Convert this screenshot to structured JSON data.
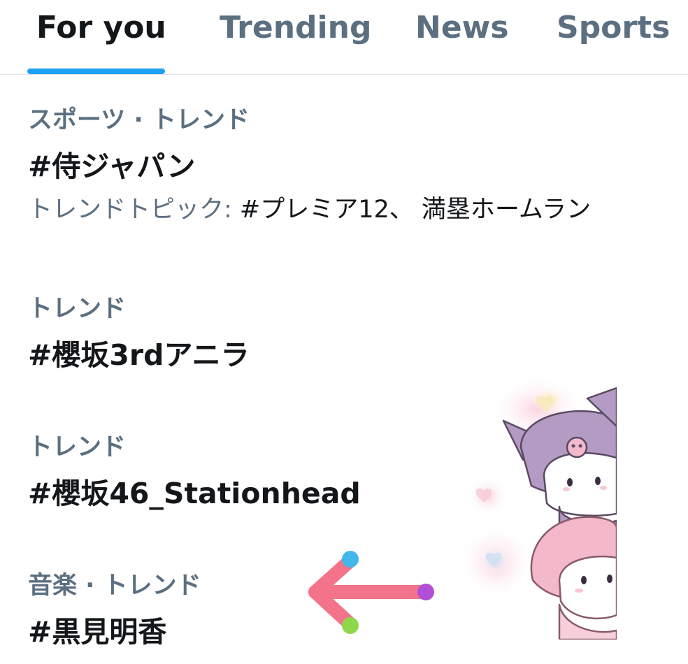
{
  "tabs": [
    {
      "label": "For you",
      "active": true
    },
    {
      "label": "Trending",
      "active": false
    },
    {
      "label": "News",
      "active": false
    },
    {
      "label": "Sports",
      "active": false
    }
  ],
  "accent_color": "#1da1f2",
  "trends": [
    {
      "meta": "スポーツ · トレンド",
      "title": "#侍ジャパン",
      "topics_label": "トレンドトピック: ",
      "topics_value": "#プレミア12、 満塁ホームラン"
    },
    {
      "meta": "トレンド",
      "title": "#櫻坂3rdアニラ"
    },
    {
      "meta": "トレンド",
      "title": "#櫻坂46_Stationhead"
    },
    {
      "meta": "音楽 · トレンド",
      "title": "#黒見明香"
    }
  ],
  "decorations": {
    "sticker": "kuromi-my-melody-sticker",
    "arrow": "left-arrow-icon",
    "arrow_color": "#f2738a"
  }
}
